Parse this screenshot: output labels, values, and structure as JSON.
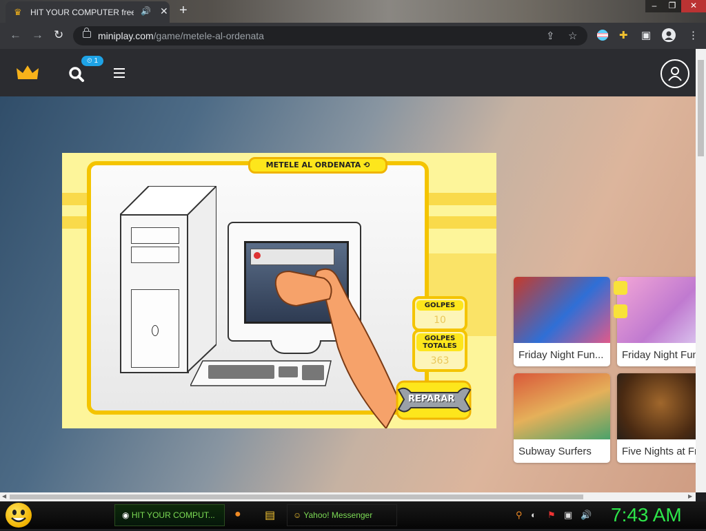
{
  "browser": {
    "tab_title": "HIT YOUR COMPUTER free c",
    "tab_close": "✕",
    "new_tab": "+",
    "url_host": "miniplay.com",
    "url_path": "/game/metele-al-ordenata"
  },
  "site": {
    "notification_count": "1"
  },
  "game": {
    "title": "METELE AL ORDENATA",
    "golpes_label": "GOLPES",
    "golpes_value": "10",
    "golpes_totales_label": "GOLPES TOTALES",
    "golpes_totales_value": "363",
    "repair_label": "REPARAR"
  },
  "cards": [
    {
      "title": "Friday Night Fun..."
    },
    {
      "title": "Friday Night Fun"
    },
    {
      "title": "Subway Surfers"
    },
    {
      "title": "Five Nights at Fr"
    }
  ],
  "taskbar": {
    "task1_label": "HIT YOUR COMPUT...",
    "task2_label": "Yahoo! Messenger",
    "clock": "7:43 AM"
  },
  "colors": {
    "accent_yellow": "#f4c400",
    "clock_green": "#2de64a",
    "site_header": "#2b2c30",
    "badge_blue": "#1ea3e6"
  }
}
